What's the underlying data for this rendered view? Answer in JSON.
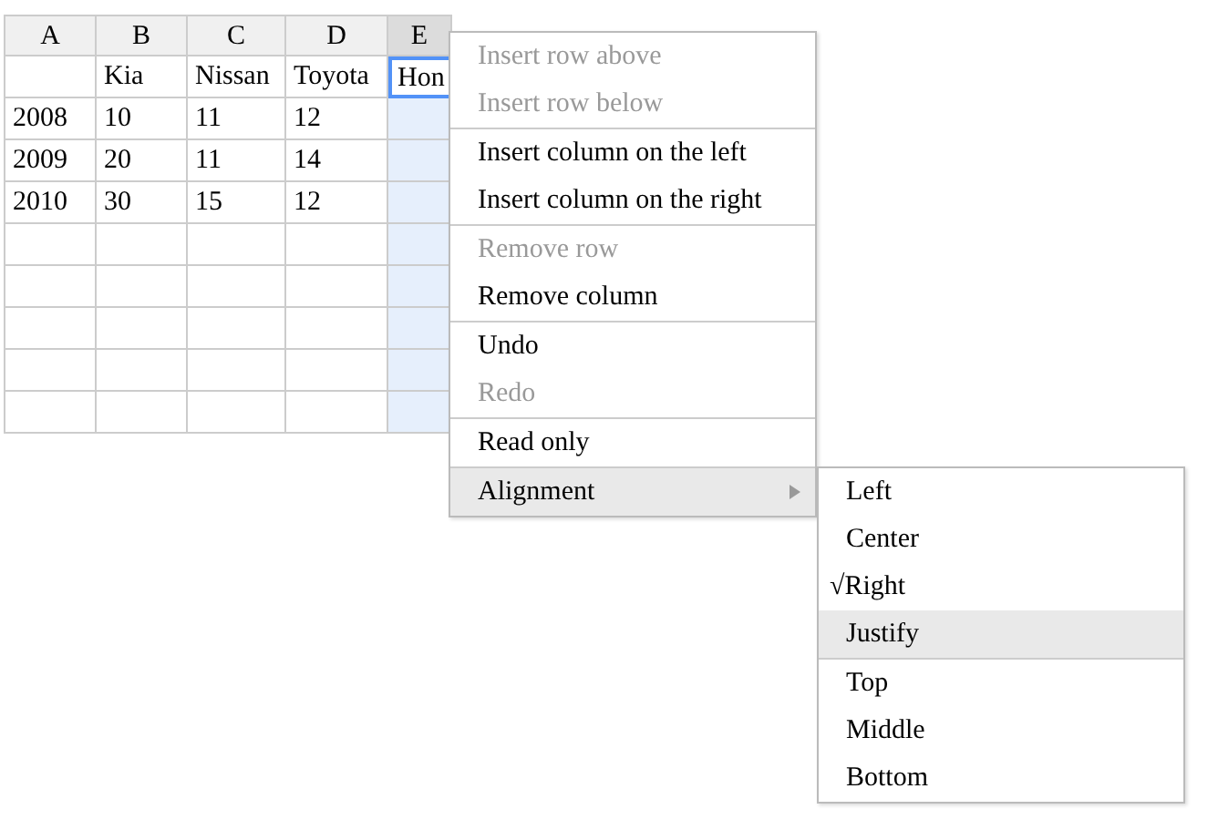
{
  "sheet": {
    "columns": [
      {
        "label": "A",
        "selected": false
      },
      {
        "label": "B",
        "selected": false
      },
      {
        "label": "C",
        "selected": false
      },
      {
        "label": "D",
        "selected": false
      },
      {
        "label": "E",
        "selected": true
      }
    ],
    "rows": [
      {
        "cells": [
          {
            "active": false
          },
          {
            "text": "Kia",
            "active": false
          },
          {
            "text": "Nissan",
            "active": false
          },
          {
            "text": "Toyota",
            "active": false
          },
          {
            "text": "Hon",
            "active": true
          }
        ]
      },
      {
        "cells": [
          {
            "text": "2008",
            "active": false
          },
          {
            "text": "10",
            "active": false
          },
          {
            "text": "11",
            "active": false
          },
          {
            "text": "12",
            "active": false
          },
          {
            "active": false
          }
        ]
      },
      {
        "cells": [
          {
            "text": "2009",
            "active": false
          },
          {
            "text": "20",
            "active": false
          },
          {
            "text": "11",
            "active": false
          },
          {
            "text": "14",
            "active": false
          },
          {
            "active": false
          }
        ]
      },
      {
        "cells": [
          {
            "text": "2010",
            "active": false
          },
          {
            "text": "30",
            "active": false
          },
          {
            "text": "15",
            "active": false
          },
          {
            "text": "12",
            "active": false
          },
          {
            "active": false
          }
        ]
      }
    ]
  },
  "context_menu": {
    "groups": [
      {
        "items": [
          {
            "label": "Insert row above",
            "disabled": true,
            "selected": false
          },
          {
            "label": "Insert row below",
            "disabled": true,
            "selected": false
          }
        ]
      },
      {
        "items": [
          {
            "label": "Insert column on the left",
            "disabled": false,
            "selected": false
          },
          {
            "label": "Insert column on the right",
            "disabled": false,
            "selected": false
          }
        ]
      },
      {
        "items": [
          {
            "label": "Remove row",
            "disabled": true,
            "selected": false
          },
          {
            "label": "Remove column",
            "disabled": false,
            "selected": false
          }
        ]
      },
      {
        "items": [
          {
            "label": "Undo",
            "disabled": false,
            "selected": false
          },
          {
            "label": "Redo",
            "disabled": true,
            "selected": false
          }
        ]
      },
      {
        "items": [
          {
            "label": "Read only",
            "disabled": false,
            "selected": false
          }
        ]
      },
      {
        "items": [
          {
            "label": "Alignment",
            "disabled": false,
            "selected": true,
            "submenu": true
          }
        ]
      }
    ]
  },
  "submenu": {
    "groups": [
      {
        "items": [
          {
            "label": "Left",
            "checked": false,
            "selected": false
          },
          {
            "label": "Center",
            "checked": false,
            "selected": false
          },
          {
            "label": "Right",
            "checked": true,
            "check": "√",
            "selected": false
          },
          {
            "label": "Justify",
            "checked": false,
            "selected": true
          }
        ]
      },
      {
        "items": [
          {
            "label": "Top",
            "checked": false,
            "selected": false
          },
          {
            "label": "Middle",
            "checked": false,
            "selected": false
          },
          {
            "label": "Bottom",
            "checked": false,
            "selected": false
          }
        ]
      }
    ]
  }
}
